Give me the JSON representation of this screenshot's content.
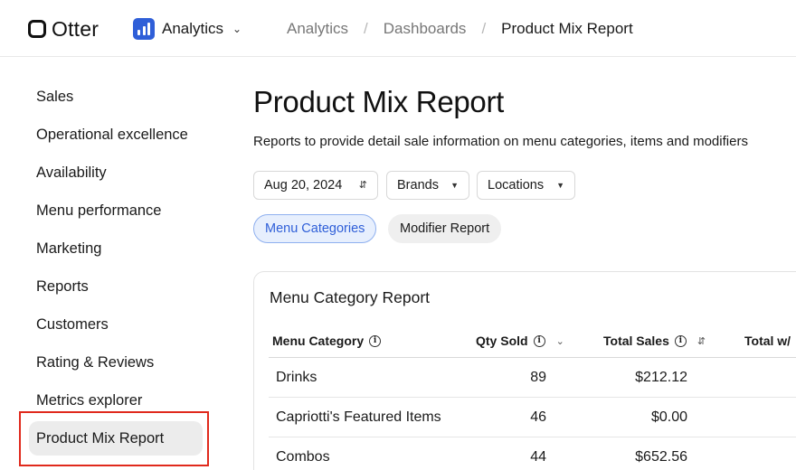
{
  "topbar": {
    "logo_text": "Otter",
    "app_name": "Analytics",
    "breadcrumbs": [
      "Analytics",
      "Dashboards",
      "Product Mix Report"
    ],
    "separator": "/"
  },
  "sidebar": {
    "items": [
      {
        "label": "Sales"
      },
      {
        "label": "Operational excellence"
      },
      {
        "label": "Availability"
      },
      {
        "label": "Menu performance"
      },
      {
        "label": "Marketing"
      },
      {
        "label": "Reports"
      },
      {
        "label": "Customers"
      },
      {
        "label": "Rating & Reviews"
      },
      {
        "label": "Metrics explorer"
      },
      {
        "label": "Product Mix Report",
        "active": true
      }
    ]
  },
  "main": {
    "title": "Product Mix Report",
    "subtitle": "Reports to provide detail sale information on menu categories, items and modifiers",
    "filters": {
      "date": "Aug 20, 2024",
      "brands": "Brands",
      "locations": "Locations"
    },
    "tabs": [
      {
        "label": "Menu Categories",
        "active": true
      },
      {
        "label": "Modifier Report",
        "active": false
      }
    ],
    "card": {
      "title": "Menu Category Report",
      "columns": [
        "Menu Category",
        "Qty Sold",
        "Total Sales",
        "Total w/"
      ],
      "rows": [
        {
          "category": "Drinks",
          "qty": "89",
          "sales": "$212.12"
        },
        {
          "category": "Capriotti's Featured Items",
          "qty": "46",
          "sales": "$0.00"
        },
        {
          "category": "Combos",
          "qty": "44",
          "sales": "$652.56"
        }
      ]
    }
  },
  "colors": {
    "accent": "#2f5fd8",
    "highlight": "#e0291c"
  }
}
